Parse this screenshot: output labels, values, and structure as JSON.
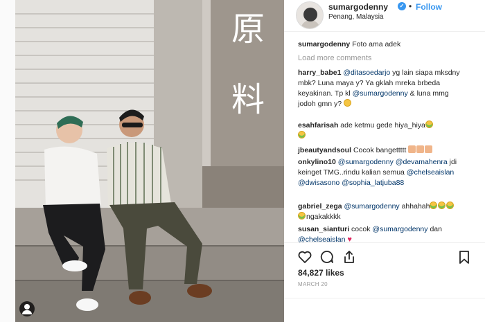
{
  "header": {
    "username": "sumargodenny",
    "verified_icon": "verified-badge-icon",
    "separator": "•",
    "follow_label": "Follow",
    "location": "Penang, Malaysia"
  },
  "caption": {
    "user": "sumargodenny",
    "text": "Foto ama adek"
  },
  "load_more_label": "Load more comments",
  "comments": [
    {
      "user": "harry_babe1",
      "parts": [
        {
          "type": "mention",
          "text": "@ditasoedarjo"
        },
        {
          "type": "text",
          "text": " yg lain siapa mksdny mbk? Luna maya y? Ya gklah mreka brbeda keyakinan. Tp kl "
        },
        {
          "type": "mention",
          "text": "@sumargodenny"
        },
        {
          "type": "text",
          "text": " & luna mmg jodoh gmn y? "
        },
        {
          "type": "emoji",
          "text": "thinking-face"
        }
      ]
    },
    {
      "user": "esahfarisah",
      "parts": [
        {
          "type": "text",
          "text": "ade ketmu gede hiya_hiya"
        },
        {
          "type": "emoji",
          "text": "grinning-sweat"
        },
        {
          "type": "emoji",
          "text": "grinning-sweat"
        }
      ]
    },
    {
      "user": "jbeautyandsoul",
      "parts": [
        {
          "type": "text",
          "text": "Cocok bangettttt "
        },
        {
          "type": "thumb",
          "text": "thumbs-up"
        },
        {
          "type": "thumb",
          "text": "thumbs-up"
        },
        {
          "type": "thumb",
          "text": "thumbs-up"
        }
      ]
    },
    {
      "user": "onkylino10",
      "parts": [
        {
          "type": "mention",
          "text": "@sumargodenny"
        },
        {
          "type": "text",
          "text": " "
        },
        {
          "type": "mention",
          "text": "@devamahenra"
        },
        {
          "type": "text",
          "text": " jdi keinget TMG..rindu kalian semua "
        },
        {
          "type": "mention",
          "text": "@chelseaislan"
        },
        {
          "type": "text",
          "text": " "
        },
        {
          "type": "mention",
          "text": "@dwisasono"
        },
        {
          "type": "text",
          "text": " "
        },
        {
          "type": "mention",
          "text": "@sophia_latjuba88"
        }
      ]
    },
    {
      "user": "gabriel_zega",
      "parts": [
        {
          "type": "mention",
          "text": "@sumargodenny"
        },
        {
          "type": "text",
          "text": " ahhahah"
        },
        {
          "type": "emoji",
          "text": "grinning-sweat"
        },
        {
          "type": "emoji",
          "text": "grinning-sweat"
        },
        {
          "type": "emoji",
          "text": "grinning-sweat"
        },
        {
          "type": "emoji",
          "text": "grinning-sweat"
        },
        {
          "type": "text",
          "text": "ngakakkkk"
        }
      ]
    },
    {
      "user": "susan_sianturi",
      "parts": [
        {
          "type": "text",
          "text": "cocok "
        },
        {
          "type": "mention",
          "text": "@sumargodenny"
        },
        {
          "type": "text",
          "text": " dan "
        },
        {
          "type": "mention",
          "text": "@chelseaislan"
        },
        {
          "type": "text",
          "text": " "
        },
        {
          "type": "heart",
          "text": "♥"
        }
      ]
    }
  ],
  "actions": {
    "like_icon": "heart-outline-icon",
    "comment_icon": "comment-bubble-icon",
    "share_icon": "share-arrow-icon",
    "save_icon": "bookmark-icon"
  },
  "likes_label": "84,827 likes",
  "date_label": "MARCH 20",
  "photo": {
    "alt_subject": "photo-of-two-people-sitting-on-steps",
    "sign_chars": [
      "原",
      "料"
    ],
    "owner_badge_icon": "user-tag-icon"
  },
  "colors": {
    "link": "#003569",
    "follow": "#3897f0",
    "muted": "#999999",
    "heart": "#e0245e"
  }
}
